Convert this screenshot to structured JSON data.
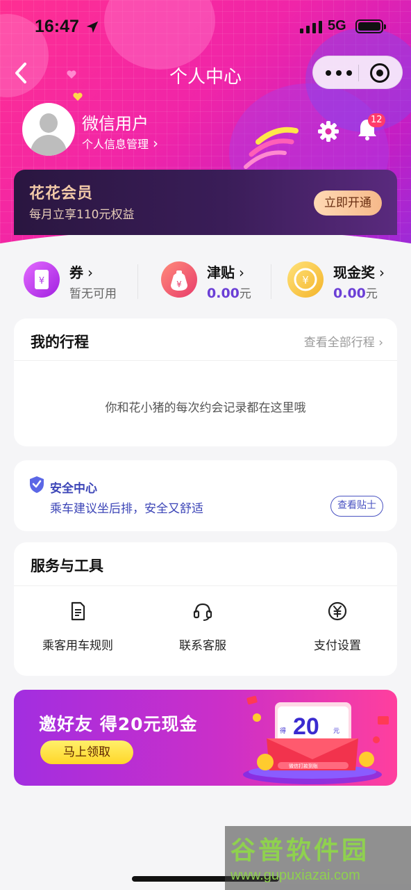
{
  "status_bar": {
    "time": "16:47",
    "network": "5G"
  },
  "navbar": {
    "title": "个人中心"
  },
  "profile": {
    "username": "微信用户",
    "manage_link": "个人信息管理",
    "notification_count": "12"
  },
  "vip": {
    "title": "花花会员",
    "subtitle": "每月立享110元权益",
    "button": "立即开通"
  },
  "assets": [
    {
      "name": "券",
      "value": "暂无可用",
      "icon": "coupon-icon"
    },
    {
      "name": "津贴",
      "amount": "0.00",
      "unit": "元",
      "icon": "money-bag-icon"
    },
    {
      "name": "现金奖",
      "amount": "0.00",
      "unit": "元",
      "icon": "coin-icon"
    }
  ],
  "trips": {
    "title": "我的行程",
    "view_all": "查看全部行程",
    "empty_text": "你和花小猪的每次约会记录都在这里哦"
  },
  "safety": {
    "title": "安全中心",
    "subtitle": "乘车建议坐后排，安全又舒适",
    "button": "查看贴士"
  },
  "tools": {
    "title": "服务与工具",
    "items": [
      {
        "label": "乘客用车规则",
        "icon": "document-icon"
      },
      {
        "label": "联系客服",
        "icon": "headset-icon"
      },
      {
        "label": "支付设置",
        "icon": "yuan-icon"
      }
    ]
  },
  "invite": {
    "title": "邀好友 得20元现金",
    "button": "马上领取",
    "amount": "20",
    "unit": "元",
    "card_caption": "得",
    "card_note": "微信打款到账"
  },
  "watermark": {
    "brand": "谷普软件园",
    "url": "www.gupuxiazai.com"
  },
  "colors": {
    "hero_start": "#ff2f92",
    "hero_end": "#9b2bd8",
    "accent_purple": "#6b3fd6",
    "safety_blue": "#3c45b7",
    "vip_gold": "#f2c9a8"
  }
}
